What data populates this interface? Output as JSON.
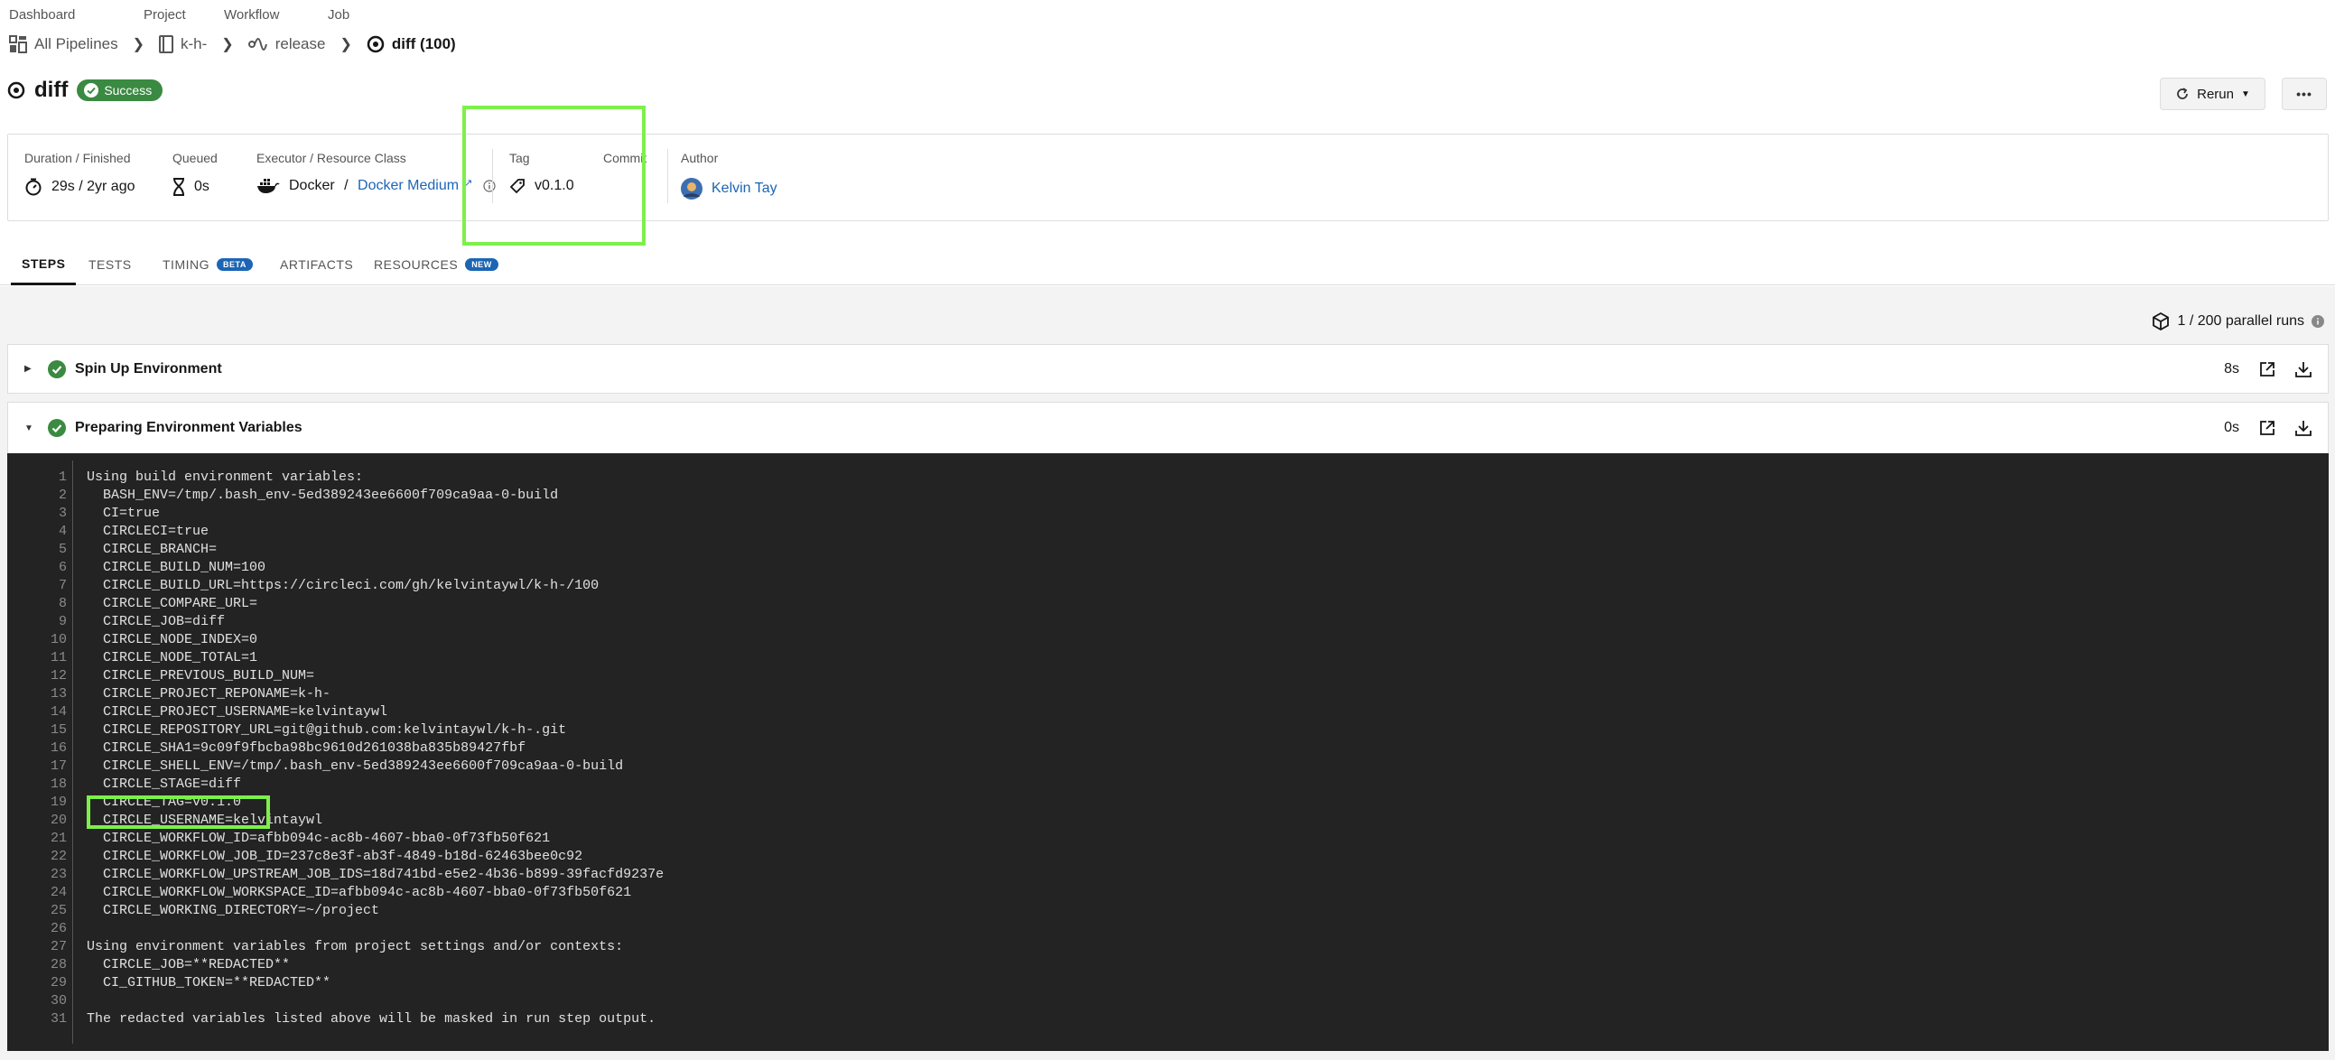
{
  "breadcrumb": {
    "labels": {
      "dashboard": "Dashboard",
      "project": "Project",
      "workflow": "Workflow",
      "job": "Job"
    },
    "all_pipelines": "All Pipelines",
    "project": "k-h-",
    "workflow": "release",
    "job": "diff (100)"
  },
  "header": {
    "title": "diff",
    "status": "Success",
    "rerun_label": "Rerun",
    "more_label": "•••"
  },
  "info": {
    "duration_label": "Duration / Finished",
    "duration_value": "29s / 2yr ago",
    "queued_label": "Queued",
    "queued_value": "0s",
    "executor_label": "Executor / Resource Class",
    "executor_value": "Docker",
    "executor_sep": " / ",
    "resource_class": "Docker Medium",
    "tag_label": "Tag",
    "tag_value": "v0.1.0",
    "commit_label": "Commit",
    "author_label": "Author",
    "author_value": "Kelvin Tay"
  },
  "tabs": [
    {
      "label": "STEPS"
    },
    {
      "label": "TESTS"
    },
    {
      "label": "TIMING",
      "badge": "BETA"
    },
    {
      "label": "ARTIFACTS"
    },
    {
      "label": "RESOURCES",
      "badge": "NEW"
    }
  ],
  "parallel_runs": "1 / 200 parallel runs",
  "steps": [
    {
      "name": "Spin Up Environment",
      "duration": "8s",
      "expanded": false
    },
    {
      "name": "Preparing Environment Variables",
      "duration": "0s",
      "expanded": true
    }
  ],
  "terminal_lines": [
    "Using build environment variables:",
    "  BASH_ENV=/tmp/.bash_env-5ed389243ee6600f709ca9aa-0-build",
    "  CI=true",
    "  CIRCLECI=true",
    "  CIRCLE_BRANCH=",
    "  CIRCLE_BUILD_NUM=100",
    "  CIRCLE_BUILD_URL=https://circleci.com/gh/kelvintaywl/k-h-/100",
    "  CIRCLE_COMPARE_URL=",
    "  CIRCLE_JOB=diff",
    "  CIRCLE_NODE_INDEX=0",
    "  CIRCLE_NODE_TOTAL=1",
    "  CIRCLE_PREVIOUS_BUILD_NUM=",
    "  CIRCLE_PROJECT_REPONAME=k-h-",
    "  CIRCLE_PROJECT_USERNAME=kelvintaywl",
    "  CIRCLE_REPOSITORY_URL=git@github.com:kelvintaywl/k-h-.git",
    "  CIRCLE_SHA1=9c09f9fbcba98bc9610d261038ba835b89427fbf",
    "  CIRCLE_SHELL_ENV=/tmp/.bash_env-5ed389243ee6600f709ca9aa-0-build",
    "  CIRCLE_STAGE=diff",
    "  CIRCLE_TAG=v0.1.0",
    "  CIRCLE_USERNAME=kelvintaywl",
    "  CIRCLE_WORKFLOW_ID=afbb094c-ac8b-4607-bba0-0f73fb50f621",
    "  CIRCLE_WORKFLOW_JOB_ID=237c8e3f-ab3f-4849-b18d-62463bee0c92",
    "  CIRCLE_WORKFLOW_UPSTREAM_JOB_IDS=18d741bd-e5e2-4b36-b899-39facfd9237e",
    "  CIRCLE_WORKFLOW_WORKSPACE_ID=afbb094c-ac8b-4607-bba0-0f73fb50f621",
    "  CIRCLE_WORKING_DIRECTORY=~/project",
    "",
    "Using environment variables from project settings and/or contexts:",
    "  CIRCLE_JOB=**REDACTED**",
    "  CI_GITHUB_TOKEN=**REDACTED**",
    "",
    "The redacted variables listed above will be masked in run step output."
  ],
  "colors": {
    "success": "#3a8a41",
    "link": "#1c65b5",
    "highlight": "#7df04a",
    "terminal_bg": "#232323",
    "beta_badge": "#1c65b5",
    "new_badge": "#1c65b5"
  }
}
